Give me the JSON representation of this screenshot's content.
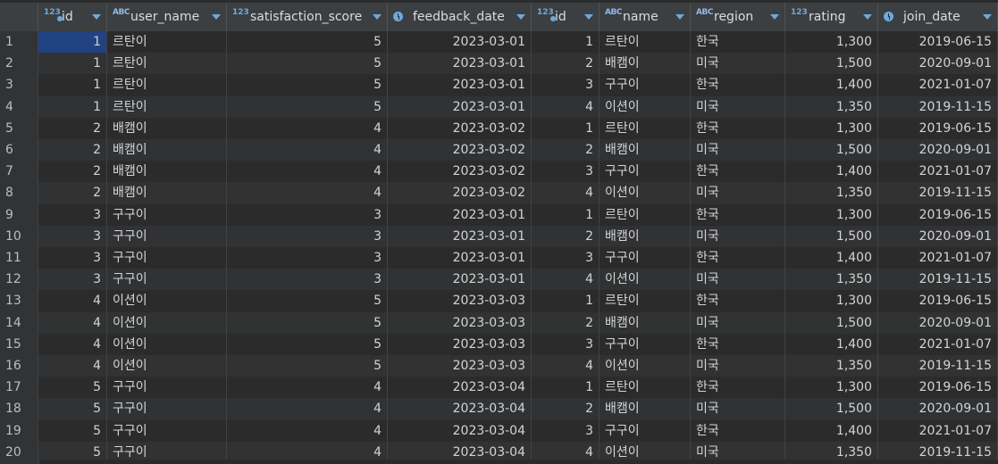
{
  "columns": [
    {
      "label": "id",
      "type": "num",
      "key": true
    },
    {
      "label": "user_name",
      "type": "abc",
      "key": false
    },
    {
      "label": "satisfaction_score",
      "type": "num",
      "key": false
    },
    {
      "label": "feedback_date",
      "type": "date",
      "key": false
    },
    {
      "label": "id",
      "type": "num",
      "key": true
    },
    {
      "label": "name",
      "type": "abc",
      "key": false
    },
    {
      "label": "region",
      "type": "abc",
      "key": false
    },
    {
      "label": "rating",
      "type": "num",
      "key": false
    },
    {
      "label": "join_date",
      "type": "date",
      "key": false
    }
  ],
  "type_icons": {
    "num": "123",
    "abc": "ABC"
  },
  "rows": [
    [
      "1",
      "1",
      "르탄이",
      "5",
      "2023-03-01",
      "1",
      "르탄이",
      "한국",
      "1,300",
      "2019-06-15"
    ],
    [
      "2",
      "1",
      "르탄이",
      "5",
      "2023-03-01",
      "2",
      "배캠이",
      "미국",
      "1,500",
      "2020-09-01"
    ],
    [
      "3",
      "1",
      "르탄이",
      "5",
      "2023-03-01",
      "3",
      "구구이",
      "한국",
      "1,400",
      "2021-01-07"
    ],
    [
      "4",
      "1",
      "르탄이",
      "5",
      "2023-03-01",
      "4",
      "이션이",
      "미국",
      "1,350",
      "2019-11-15"
    ],
    [
      "5",
      "2",
      "배캠이",
      "4",
      "2023-03-02",
      "1",
      "르탄이",
      "한국",
      "1,300",
      "2019-06-15"
    ],
    [
      "6",
      "2",
      "배캠이",
      "4",
      "2023-03-02",
      "2",
      "배캠이",
      "미국",
      "1,500",
      "2020-09-01"
    ],
    [
      "7",
      "2",
      "배캠이",
      "4",
      "2023-03-02",
      "3",
      "구구이",
      "한국",
      "1,400",
      "2021-01-07"
    ],
    [
      "8",
      "2",
      "배캠이",
      "4",
      "2023-03-02",
      "4",
      "이션이",
      "미국",
      "1,350",
      "2019-11-15"
    ],
    [
      "9",
      "3",
      "구구이",
      "3",
      "2023-03-01",
      "1",
      "르탄이",
      "한국",
      "1,300",
      "2019-06-15"
    ],
    [
      "10",
      "3",
      "구구이",
      "3",
      "2023-03-01",
      "2",
      "배캠이",
      "미국",
      "1,500",
      "2020-09-01"
    ],
    [
      "11",
      "3",
      "구구이",
      "3",
      "2023-03-01",
      "3",
      "구구이",
      "한국",
      "1,400",
      "2021-01-07"
    ],
    [
      "12",
      "3",
      "구구이",
      "3",
      "2023-03-01",
      "4",
      "이션이",
      "미국",
      "1,350",
      "2019-11-15"
    ],
    [
      "13",
      "4",
      "이션이",
      "5",
      "2023-03-03",
      "1",
      "르탄이",
      "한국",
      "1,300",
      "2019-06-15"
    ],
    [
      "14",
      "4",
      "이션이",
      "5",
      "2023-03-03",
      "2",
      "배캠이",
      "미국",
      "1,500",
      "2020-09-01"
    ],
    [
      "15",
      "4",
      "이션이",
      "5",
      "2023-03-03",
      "3",
      "구구이",
      "한국",
      "1,400",
      "2021-01-07"
    ],
    [
      "16",
      "4",
      "이션이",
      "5",
      "2023-03-03",
      "4",
      "이션이",
      "미국",
      "1,350",
      "2019-11-15"
    ],
    [
      "17",
      "5",
      "구구이",
      "4",
      "2023-03-04",
      "1",
      "르탄이",
      "한국",
      "1,300",
      "2019-06-15"
    ],
    [
      "18",
      "5",
      "구구이",
      "4",
      "2023-03-04",
      "2",
      "배캠이",
      "미국",
      "1,500",
      "2020-09-01"
    ],
    [
      "19",
      "5",
      "구구이",
      "4",
      "2023-03-04",
      "3",
      "구구이",
      "한국",
      "1,400",
      "2021-01-07"
    ],
    [
      "20",
      "5",
      "구구이",
      "4",
      "2023-03-04",
      "4",
      "이션이",
      "미국",
      "1,350",
      "2019-11-15"
    ]
  ],
  "colors": {
    "background": "#2b2b2b",
    "header": "#3c3f41",
    "selection": "#214283",
    "icon_accent": "#6fa8dc"
  }
}
